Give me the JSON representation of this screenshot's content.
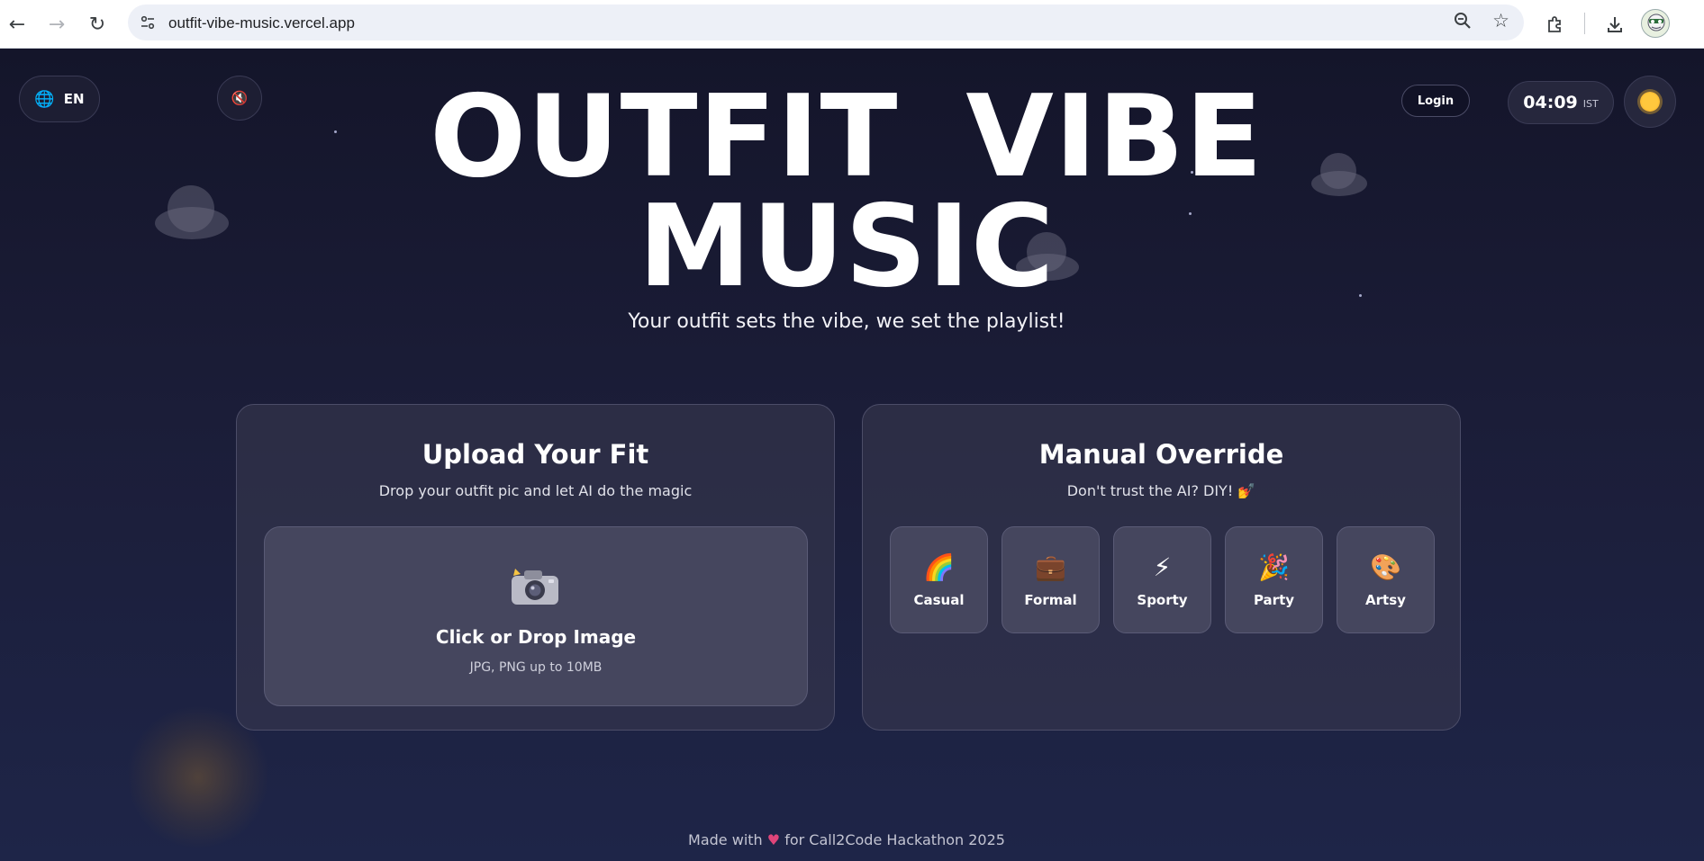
{
  "browser": {
    "url": "outfit-vibe-music.vercel.app"
  },
  "header": {
    "language": "EN",
    "login_label": "Login",
    "clock_time": "04:09",
    "clock_zone": "IST"
  },
  "hero": {
    "title_line1": "OUTFIT VIBE",
    "title_line2": "MUSIC",
    "tagline": "Your outfit sets the vibe, we set the playlist!"
  },
  "upload": {
    "title": "Upload Your Fit",
    "subtitle": "Drop your outfit pic and let AI do the magic",
    "drop_title": "Click or Drop Image",
    "drop_hint": "JPG, PNG up to 10MB"
  },
  "manual": {
    "title": "Manual Override",
    "subtitle": "Don't trust the AI? DIY! 💅",
    "vibes": [
      {
        "label": "Casual",
        "icon": "rainbow-icon",
        "glyph": "🌈"
      },
      {
        "label": "Formal",
        "icon": "briefcase-icon",
        "glyph": "💼"
      },
      {
        "label": "Sporty",
        "icon": "lightning-icon",
        "glyph": "⚡"
      },
      {
        "label": "Party",
        "icon": "party-popper-icon",
        "glyph": "🎉"
      },
      {
        "label": "Artsy",
        "icon": "palette-icon",
        "glyph": "🎨"
      }
    ]
  },
  "footer": {
    "prefix": "Made with",
    "heart": "♥",
    "suffix": "for Call2Code Hackathon 2025"
  }
}
